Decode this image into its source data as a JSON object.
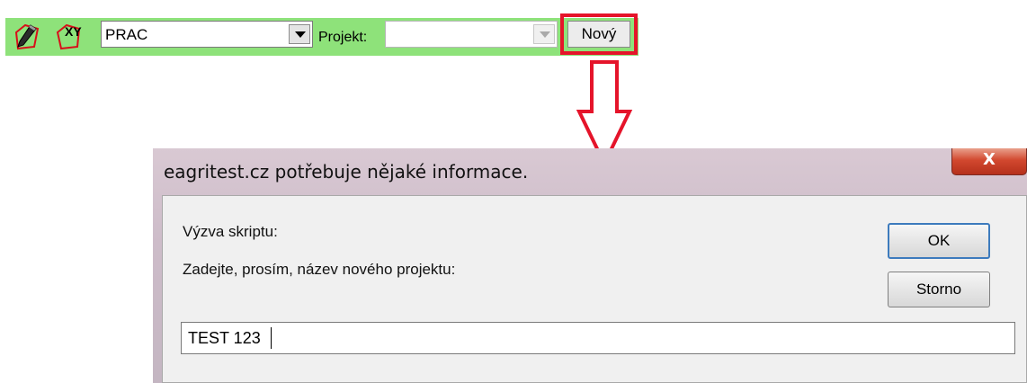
{
  "toolbar": {
    "edit_icon": "pencil-polygon-icon",
    "xy_icon": "xy-polygon-icon",
    "xy_icon_text": "XY",
    "layer_combo_value": "PRAC",
    "project_label": "Projekt:",
    "project_combo_value": "",
    "new_button_label": "Nový",
    "background_color": "#8ee27a",
    "highlight_color": "#e5142a"
  },
  "dialog": {
    "title": "eagritest.cz potřebuje nějaké informace.",
    "close_label": "X",
    "prompt_heading": "Výzva skriptu:",
    "prompt_text": "Zadejte, prosím, název nového projektu:",
    "ok_label": "OK",
    "cancel_label": "Storno",
    "input_value": "TEST 123"
  }
}
